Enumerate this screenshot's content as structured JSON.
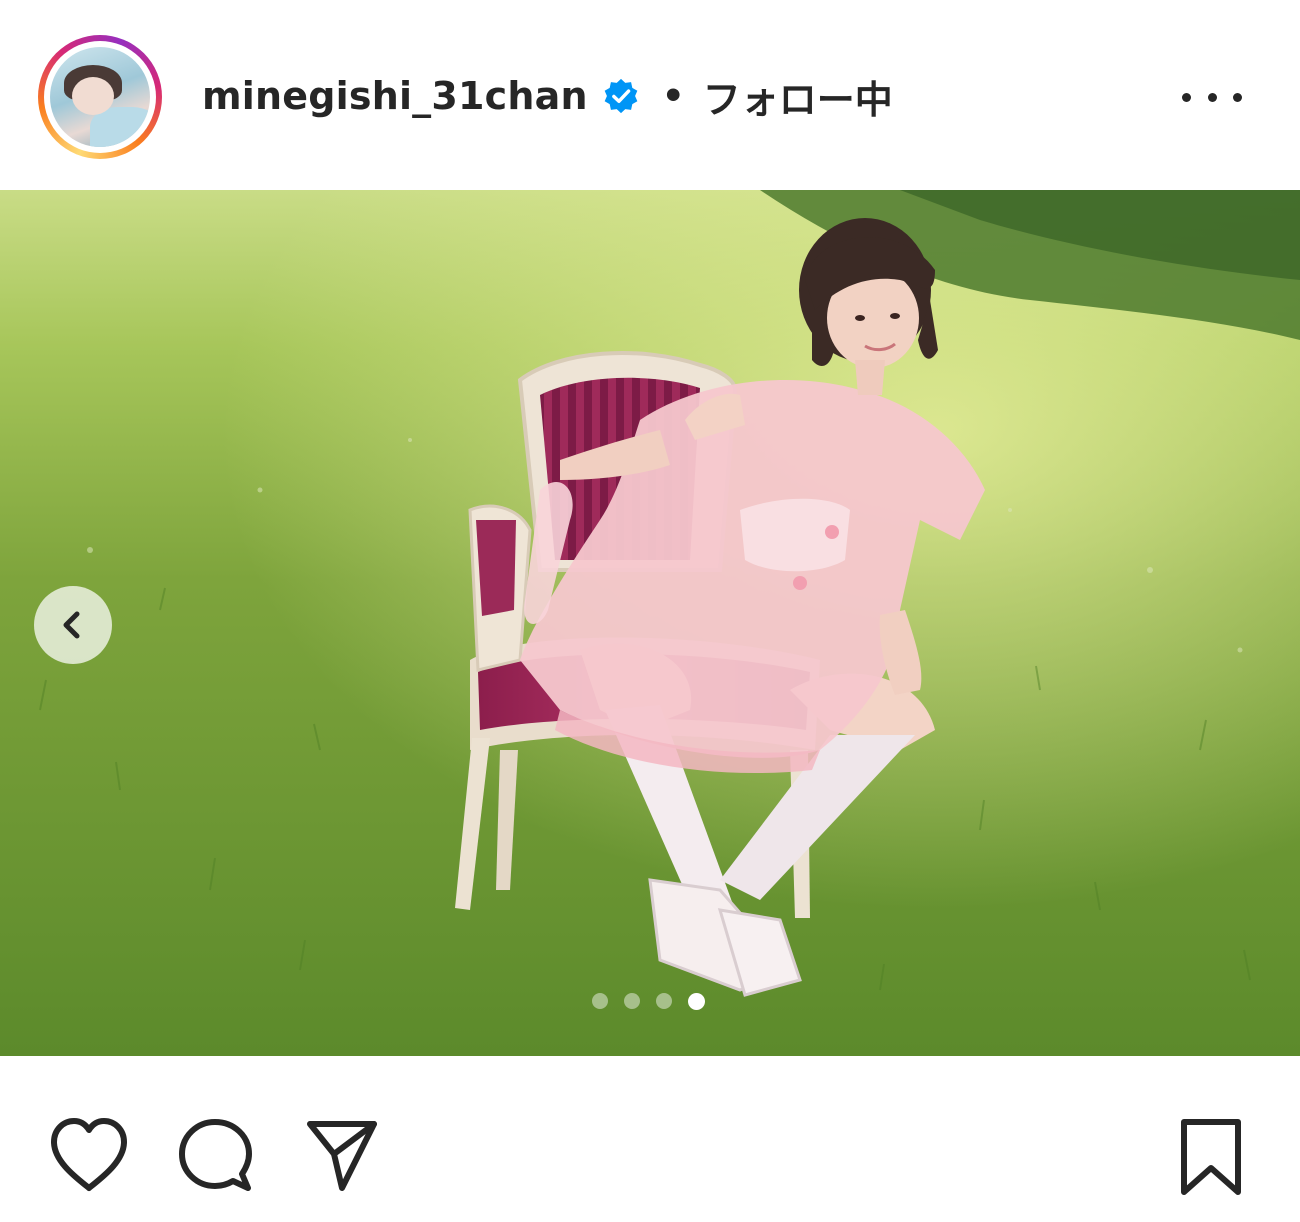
{
  "post": {
    "header": {
      "username": "minegishi_31chan",
      "verified": true,
      "separator": "•",
      "follow_status": "フォロー中",
      "more_icon": "more-horizontal-icon"
    },
    "media": {
      "alt_hint": "photo",
      "carousel": {
        "total": 4,
        "active_index": 4
      },
      "prev_icon": "chevron-left-icon"
    },
    "actions": {
      "like_icon": "heart-icon",
      "comment_icon": "comment-icon",
      "share_icon": "paper-plane-icon",
      "save_icon": "bookmark-icon"
    },
    "colors": {
      "verified_blue": "#0095f6",
      "text": "#262626",
      "story_ring": [
        "#feda75",
        "#fa7e1e",
        "#d62976",
        "#962fbf"
      ]
    }
  }
}
